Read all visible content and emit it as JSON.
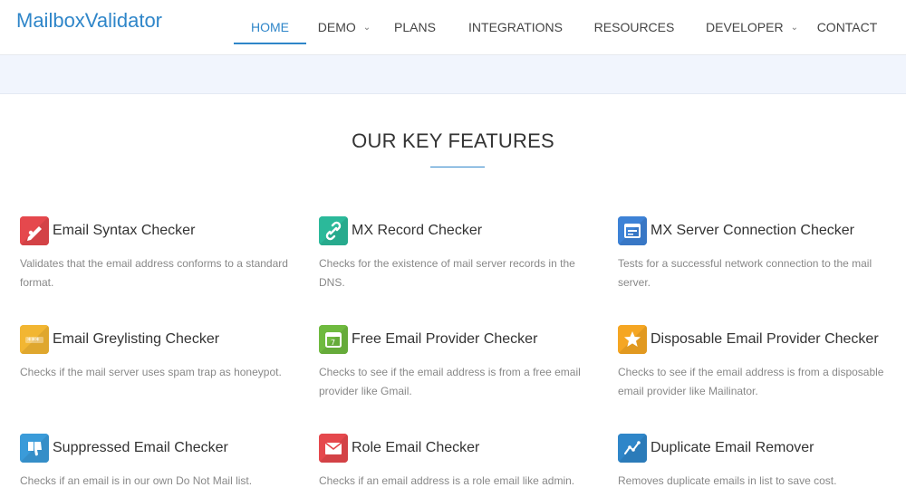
{
  "brand": {
    "name": "MailboxValidator"
  },
  "nav": {
    "items": [
      {
        "label": "HOME",
        "active": true
      },
      {
        "label": "DEMO",
        "dropdown": true
      },
      {
        "label": "PLANS"
      },
      {
        "label": "INTEGRATIONS"
      },
      {
        "label": "RESOURCES"
      },
      {
        "label": "DEVELOPER",
        "dropdown": true
      },
      {
        "label": "CONTACT"
      }
    ]
  },
  "colors": {
    "accent": "#2f86c9",
    "banner": "#f1f5fd"
  },
  "section": {
    "title": "OUR KEY FEATURES"
  },
  "features": [
    {
      "title": "Email Syntax Checker",
      "desc": "Validates that the email address conforms to a standard format.",
      "icon": "pen-icon",
      "color": "#e5484d"
    },
    {
      "title": "MX Record Checker",
      "desc": "Checks for the existence of mail server records in the DNS.",
      "icon": "link-icon",
      "color": "#2bb99a"
    },
    {
      "title": "MX Server Connection Checker",
      "desc": "Tests for a successful network connection to the mail server.",
      "icon": "window-icon",
      "color": "#3d82d6"
    },
    {
      "title": "Email Greylisting Checker",
      "desc": "Checks if the mail server uses spam trap as honeypot.",
      "icon": "password-icon",
      "color": "#f2b632"
    },
    {
      "title": "Free Email Provider Checker",
      "desc": "Checks to see if the email address is from a free email provider like Gmail.",
      "icon": "calendar-icon",
      "color": "#6fba3f"
    },
    {
      "title": "Disposable Email Provider Checker",
      "desc": "Checks to see if the email address is from a disposable email provider like Mailinator.",
      "icon": "star-icon",
      "color": "#f5a623"
    },
    {
      "title": "Suppressed Email Checker",
      "desc": "Checks if an email is in our own Do Not Mail list.",
      "icon": "thumbs-down-icon",
      "color": "#3a9bd9"
    },
    {
      "title": "Role Email Checker",
      "desc": "Checks if an email address is a role email like admin.",
      "icon": "envelope-icon",
      "color": "#e5484d"
    },
    {
      "title": "Duplicate Email Remover",
      "desc": "Removes duplicate emails in list to save cost.",
      "icon": "chart-icon",
      "color": "#2f86c9"
    }
  ]
}
